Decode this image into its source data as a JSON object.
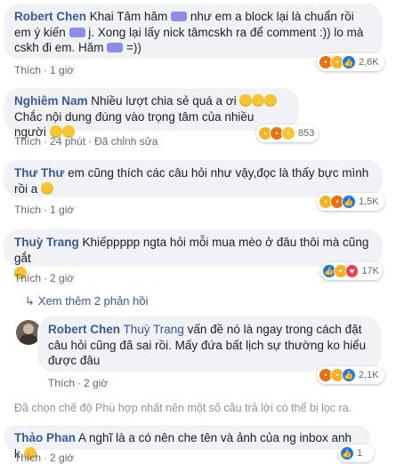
{
  "comments": [
    {
      "author": "Robert Chen",
      "text_parts": [
        "Khai Tâm hăm ",
        " như em a block lại là chuẩn rồi em ý kiến ",
        " j. Xong lại lấy nick tâmcskh ra để comment :)) lo mà cskh đi em. Hăm ",
        " =))"
      ],
      "time_action": "Thích",
      "time": "1 giờ",
      "reactions_count": "2,6K"
    },
    {
      "author": "Nghiêm Nam",
      "text": "Nhiều lượt chia sẻ quá a ơi",
      "text2": "Chắc nội dung đúng vào trọng tâm của nhiều người",
      "time_action": "Thích",
      "time": "24 phút",
      "edited": "Đã chỉnh sửa",
      "reactions_count": "853"
    },
    {
      "author": "Thư Thư",
      "text": "em cũng thích các câu hỏi như vậy,đọc là thấy bực mình rồi a",
      "time_action": "Thích",
      "time": "1 giờ",
      "reactions_count": "1,5K"
    },
    {
      "author": "Thuỳ Trang",
      "text": "Khiếppppp ngta hỏi mỗi mua mèo ở đâu thôi mà cũng gắt",
      "time_action": "Thích",
      "time": "2 giờ",
      "reactions_count": "17K"
    },
    {
      "author": "Robert Chen",
      "mention": "Thuỳ Trang",
      "text": " vấn đề nó là ngay trong cách đặt câu hỏi cũng đã sai rồi. Mấy đứa bất lịch sự thường ko hiểu được đâu",
      "time_action": "Thích",
      "time": "2 giờ",
      "reactions_count": "2,1K"
    },
    {
      "author": "Thảo Phan",
      "text": "A nghĩ là a có nên che tên và ảnh của ng inbox anh k",
      "time_action": "Thích",
      "time": "2 giờ",
      "reactions_count": "1"
    }
  ],
  "view_more_replies": "Xem thêm 2 phản hồi",
  "filter_notice": "Đã chọn chế độ Phù hợp nhất nên một số câu trả lời có thể bị lọc ra.",
  "colors": {
    "link": "#385898",
    "bubble": "#f0f2f5",
    "meta": "#65676b"
  }
}
